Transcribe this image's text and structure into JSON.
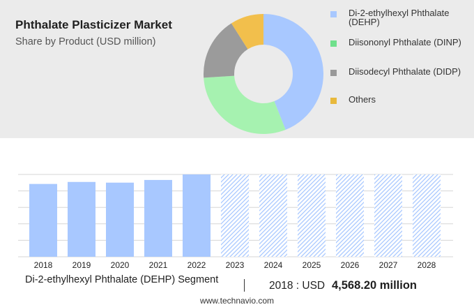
{
  "header": {
    "title": "Phthalate Plasticizer Market",
    "subtitle": "Share by Product (USD million)"
  },
  "colors": {
    "panel_bg": "#ebebeb",
    "dehp": "#a8c8ff",
    "dinp": "#a6f2b0",
    "didp": "#9b9b9b",
    "others": "#f2bf4c",
    "legend_dehp": "#a8c8ff",
    "legend_dinp": "#6fe08c",
    "legend_didp": "#999999",
    "legend_others": "#e8b93c",
    "forecast_hatch": "#a8c8ff"
  },
  "chart_data": [
    {
      "type": "pie",
      "donut": true,
      "slices": [
        {
          "label": "Di-2-ethylhexyl Phthalate (DEHP)",
          "value": 44
        },
        {
          "label": "Diisononyl Phthalate (DINP)",
          "value": 30
        },
        {
          "label": "Diisodecyl Phthalate (DIDP)",
          "value": 17
        },
        {
          "label": "Others",
          "value": 9
        }
      ],
      "legend_position": "right"
    },
    {
      "type": "bar",
      "categories": [
        "2018",
        "2019",
        "2020",
        "2021",
        "2022",
        "2023",
        "2024",
        "2025",
        "2026",
        "2027",
        "2028"
      ],
      "values": [
        4568.2,
        4694,
        4650,
        4818,
        5165,
        5165,
        5165,
        5165,
        5165,
        5165,
        5165
      ],
      "forecast_from": "2023",
      "ylim": [
        0,
        5165
      ],
      "grid": true
    }
  ],
  "footer": {
    "segment_label": "Di-2-ethylhexyl Phthalate (DEHP) Segment",
    "year_text": "2018 : USD",
    "value_text": "4,568.20 million",
    "source": "www.technavio.com"
  }
}
